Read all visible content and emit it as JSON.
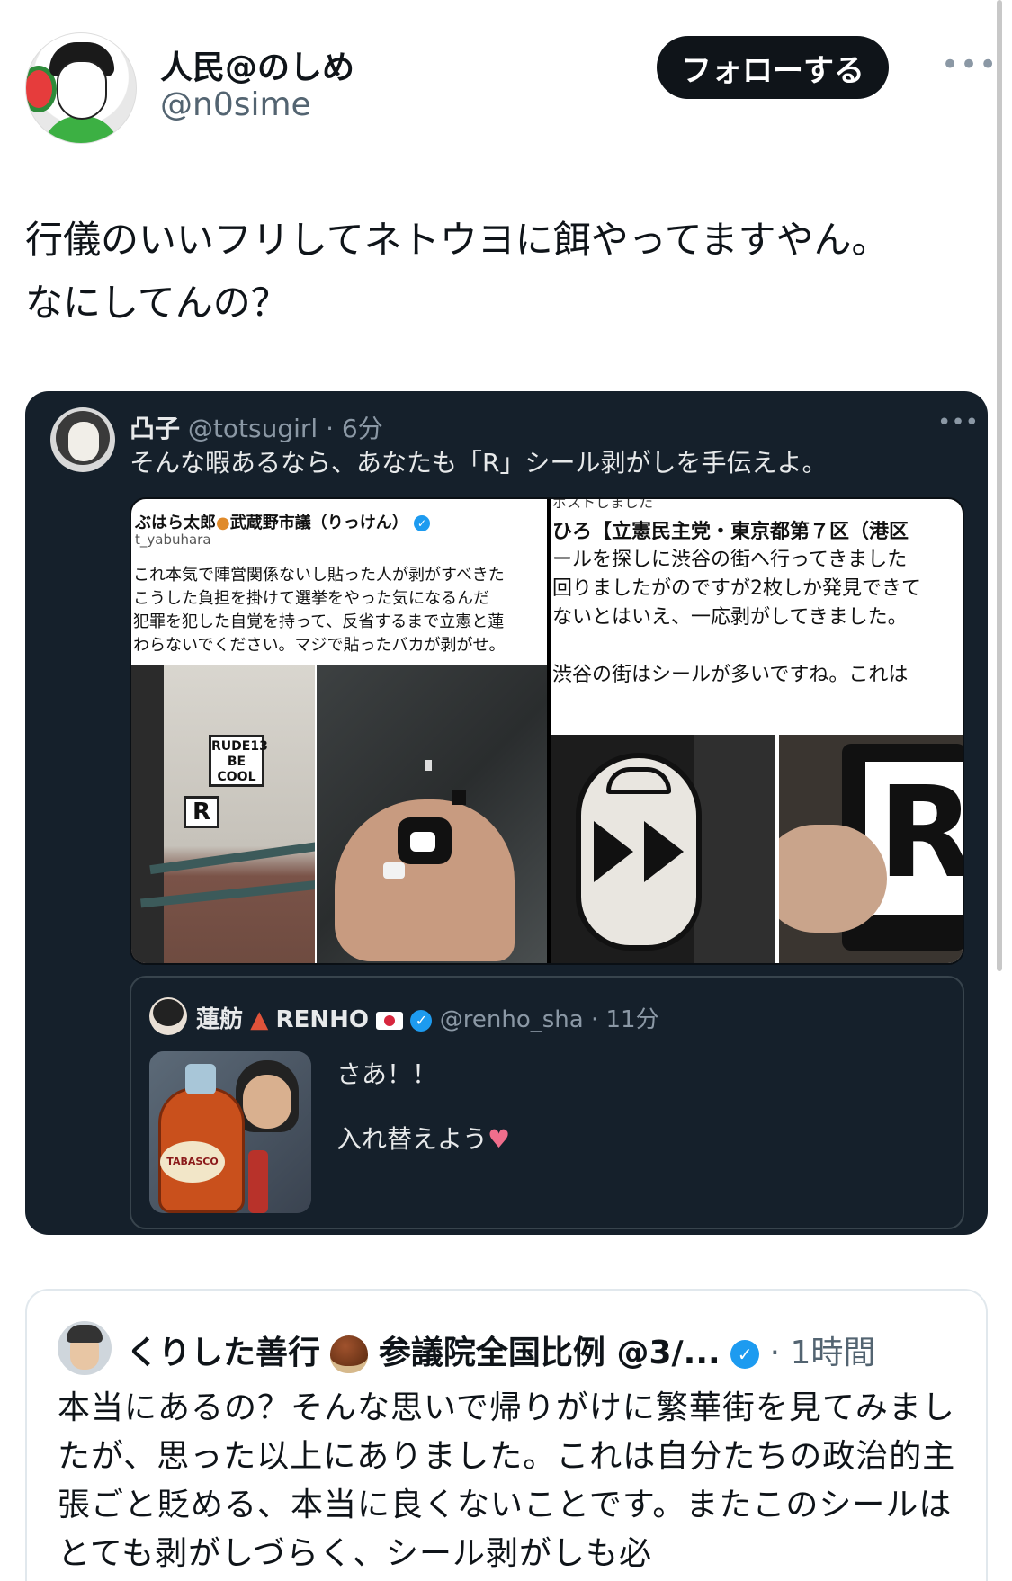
{
  "author": {
    "display_name": "人民@のしめ",
    "handle": "@n0sime",
    "follow_label": "フォローする",
    "more": "•••"
  },
  "tweet": {
    "line1": "行儀のいいフリしてネトウヨに餌やってますやん。",
    "line2": "なにしてんの？"
  },
  "quote": {
    "name": "凸子",
    "handle": "@totsugirl",
    "time": "· 6分",
    "more": "•••",
    "text": "そんな暇あるなら、あなたも「R」シール剥がしを手伝えよ。",
    "media": {
      "left": {
        "name": "ぶはら太郎",
        "name_rest": "武蔵野市議（りっけん）",
        "handle": "t_yabuhara",
        "lines": [
          "これ本気で陣営関係ないし貼った人が剥がすべきた",
          "こうした負担を掛けて選挙をやった気になるんだ",
          "犯罪を犯した自覚を持って、反省するまで立憲と蓮",
          "わらないでください。マジで貼ったバカが剥がせ。"
        ],
        "sticker_line1": "RUDE13",
        "sticker_line2": "BE",
        "sticker_line3": "COOL",
        "r_mark": "R"
      },
      "right": {
        "top_cut": "ポストしました",
        "name": "ひろ【立憲民主党・東京都第７区（港区",
        "lines": [
          "ールを探しに渋谷の街へ行ってきました",
          "回りましたがのですが2枚しか発見できて",
          "ないとはいえ、一応剥がしてきました。",
          "",
          "渋谷の街はシールが多いですね。これは"
        ],
        "r_mark": "R"
      }
    },
    "reply": {
      "name": "蓮舫",
      "name2": "RENHO",
      "handle": "@renho_sha",
      "time": "· 11分",
      "line1": "さあ！！",
      "line2": "入れ替えよう",
      "heart": "♥",
      "bottle_label": "TABASCO"
    }
  },
  "quote2": {
    "name": "くりした善行",
    "name2": "参議院全国比例 @3/...",
    "time": "· 1時間",
    "text": "本当にあるの？そんな思いで帰りがけに繁華街を見てみましたが、思った以上にありました。これは自分たちの政治的主張ごと貶める、本当に良くないことです。またこのシールはとても剥がしづらく、シール剥がしも必"
  },
  "colors": {
    "dark_card": "#15202b",
    "accent": "#1d9bf0",
    "follow_bg": "#0f1419"
  }
}
